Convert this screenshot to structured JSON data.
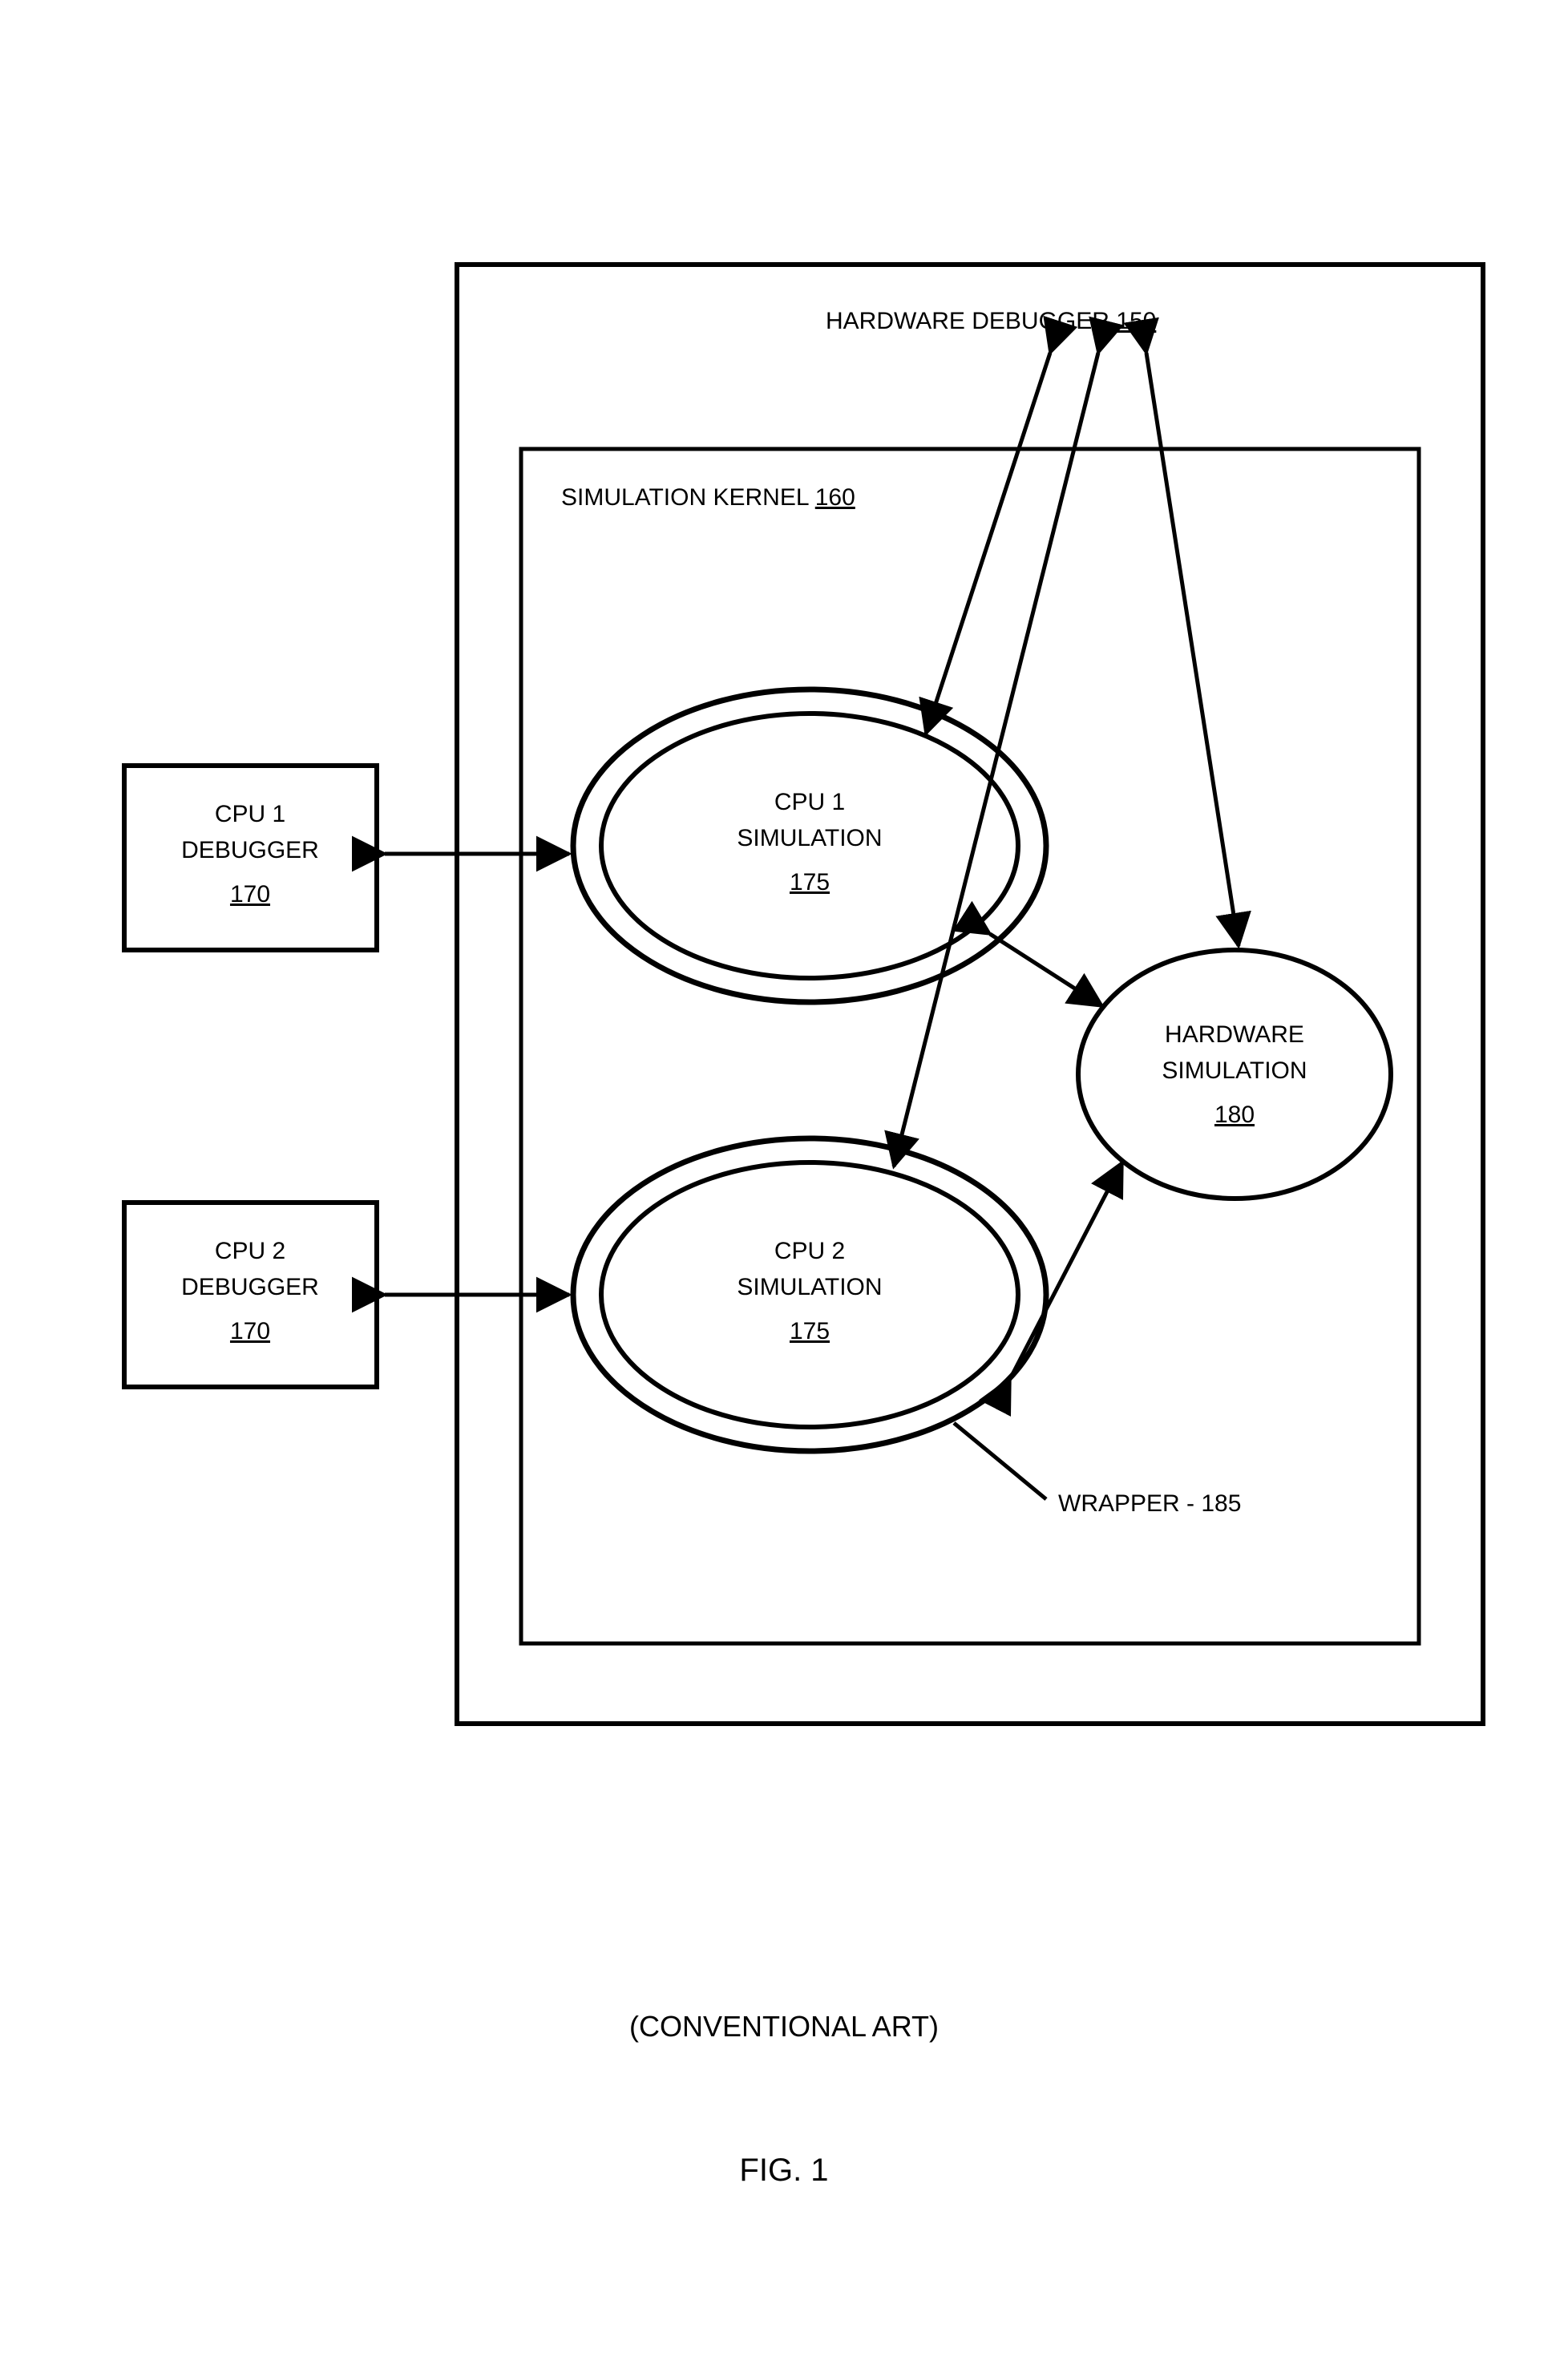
{
  "boxes": {
    "cpu1_debugger": {
      "lines": [
        "CPU 1",
        "DEBUGGER"
      ],
      "ref": "170"
    },
    "cpu2_debugger": {
      "lines": [
        "CPU 2",
        "DEBUGGER"
      ],
      "ref": "170"
    }
  },
  "hardware_debugger": {
    "label": "HARDWARE DEBUGGER",
    "ref": "150"
  },
  "simulation_kernel": {
    "label": "SIMULATION KERNEL",
    "ref": "160"
  },
  "ellipses": {
    "cpu1_sim": {
      "lines": [
        "CPU 1",
        "SIMULATION"
      ],
      "ref": "175"
    },
    "cpu2_sim": {
      "lines": [
        "CPU 2",
        "SIMULATION"
      ],
      "ref": "175"
    },
    "hw_sim": {
      "lines": [
        "HARDWARE",
        "SIMULATION"
      ],
      "ref": "180"
    }
  },
  "wrapper_label": "WRAPPER - 185",
  "caption": "(CONVENTIONAL ART)",
  "figure_label": "FIG. 1"
}
